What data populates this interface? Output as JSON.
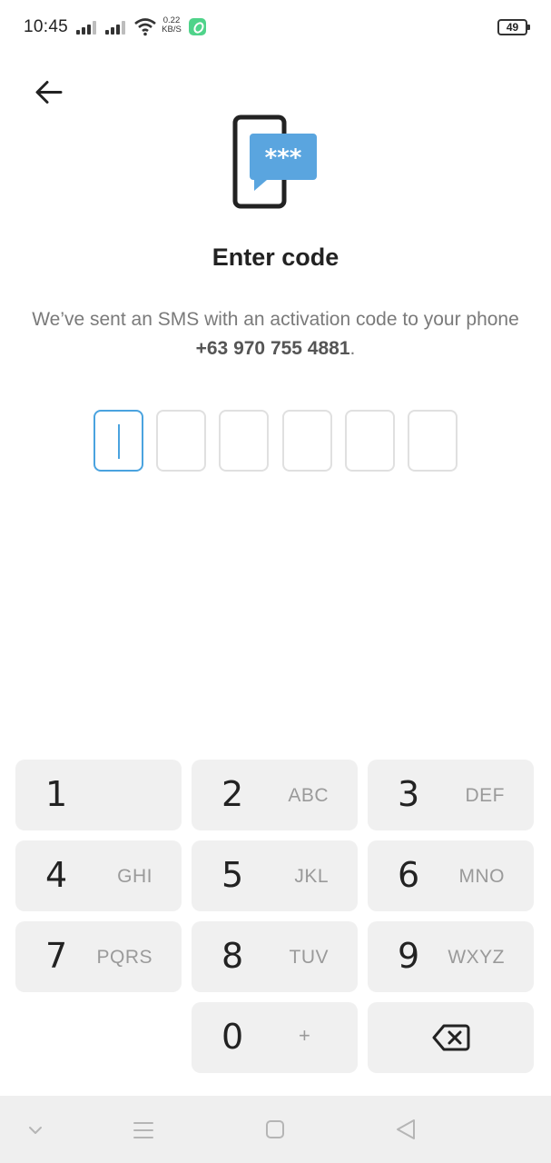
{
  "status_bar": {
    "time": "10:45",
    "network_speed_value": "0.22",
    "network_speed_unit": "KB/S",
    "battery_level": "49"
  },
  "header": {
    "title": "Enter code",
    "subtitle_prefix": "We’ve sent an SMS with an activation code to your phone ",
    "phone_number": "+63 970 755 4881",
    "subtitle_suffix": "."
  },
  "code_input": {
    "length": 6,
    "entered": "",
    "active_index": 0
  },
  "keypad": {
    "keys": [
      {
        "digit": "1",
        "letters": ""
      },
      {
        "digit": "2",
        "letters": "ABC"
      },
      {
        "digit": "3",
        "letters": "DEF"
      },
      {
        "digit": "4",
        "letters": "GHI"
      },
      {
        "digit": "5",
        "letters": "JKL"
      },
      {
        "digit": "6",
        "letters": "MNO"
      },
      {
        "digit": "7",
        "letters": "PQRS"
      },
      {
        "digit": "8",
        "letters": "TUV"
      },
      {
        "digit": "9",
        "letters": "WXYZ"
      },
      {
        "digit": "0",
        "letters": "+"
      }
    ],
    "delete_icon": "backspace-icon"
  },
  "icons": {
    "back": "arrow-left-icon",
    "illustration": "phone-sms-code-icon",
    "nav": [
      "chevron-down-icon",
      "menu-icon",
      "home-square-icon",
      "back-triangle-icon"
    ]
  },
  "colors": {
    "accent": "#4aa3df",
    "sms_bubble": "#5aa5df",
    "key_background": "#f0f0f0",
    "nav_background": "#efefef"
  }
}
